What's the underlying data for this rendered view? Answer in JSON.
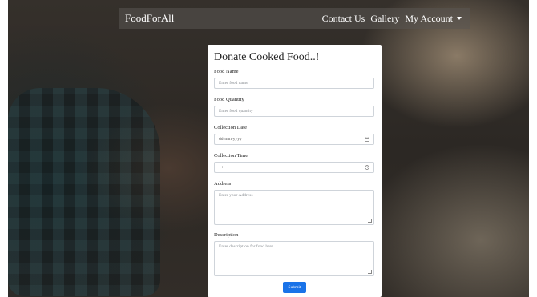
{
  "navbar": {
    "brand": "FoodForAll",
    "links": [
      "Contact Us",
      "Gallery",
      "My Account"
    ]
  },
  "form": {
    "title": "Donate Cooked Food..!",
    "food_name": {
      "label": "Food Name",
      "placeholder": "Enter food name"
    },
    "food_quantity": {
      "label": "Food Quantity",
      "placeholder": "Enter food quantity"
    },
    "collection_date": {
      "label": "Collection Date",
      "placeholder": "dd-mm-yyyy",
      "icon": "calendar-icon"
    },
    "collection_time": {
      "label": "Collection Time",
      "placeholder": "--:--",
      "icon": "clock-icon"
    },
    "address": {
      "label": "Address",
      "placeholder": "Enter your Address"
    },
    "description": {
      "label": "Description",
      "placeholder": "Enter description for food here"
    },
    "submit_label": "Submit"
  },
  "colors": {
    "accent": "#1a73e8",
    "navbar_text": "#ffffff"
  }
}
